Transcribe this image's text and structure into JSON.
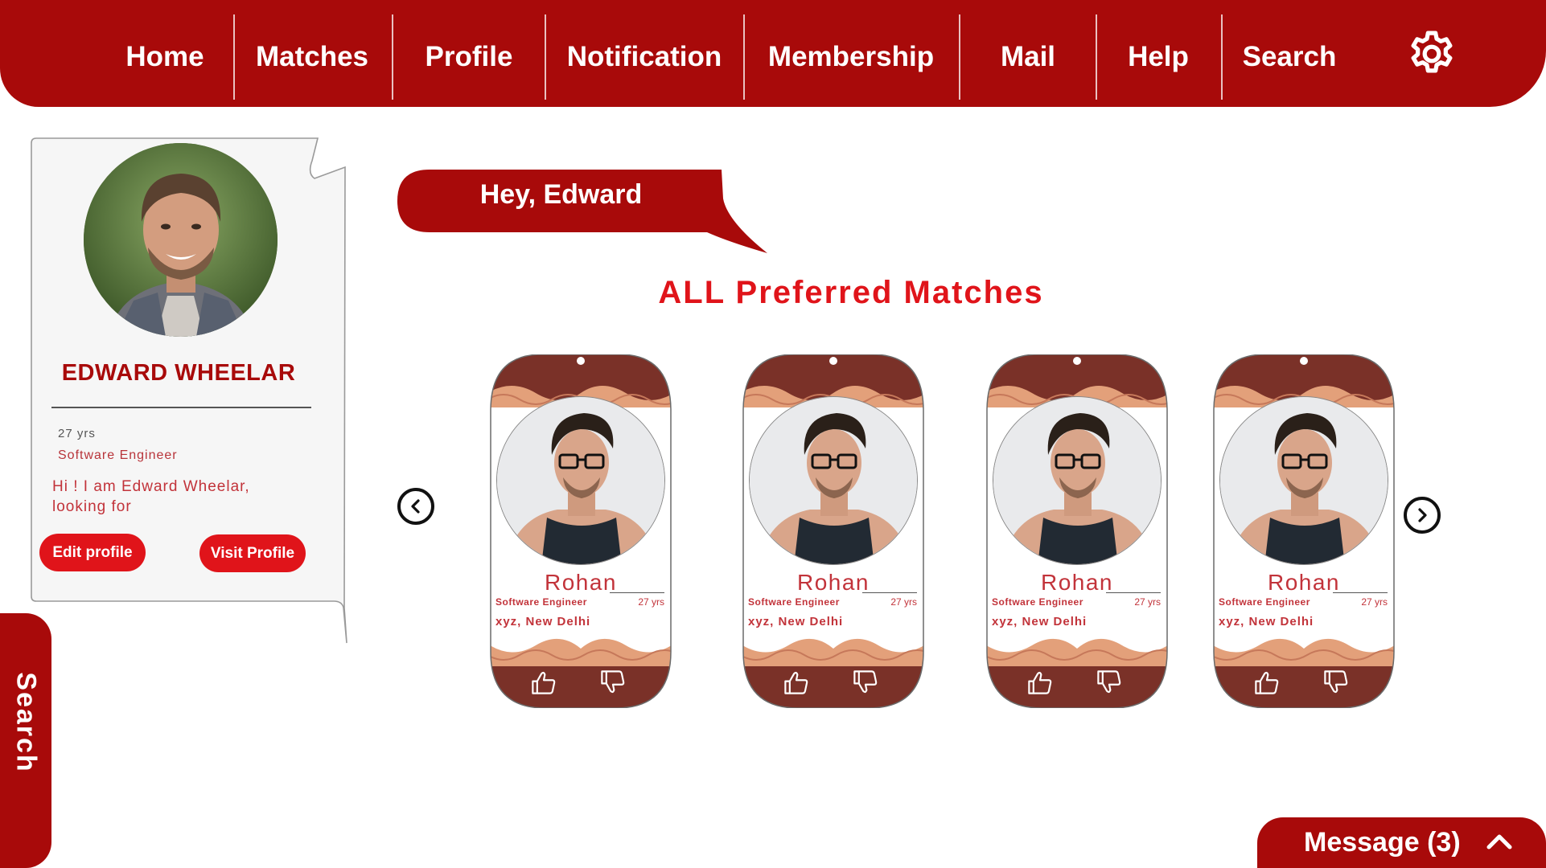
{
  "nav": {
    "items": [
      {
        "label": "Home"
      },
      {
        "label": "Matches"
      },
      {
        "label": "Profile"
      },
      {
        "label": "Notification"
      },
      {
        "label": "Membership"
      },
      {
        "label": "Mail"
      },
      {
        "label": "Help"
      },
      {
        "label": "Search"
      }
    ],
    "settings_icon": "gear-icon"
  },
  "profile": {
    "name": "EDWARD WHEELAR",
    "age": "27 yrs",
    "job": "Software Engineer",
    "bio": "Hi ! I am Edward Wheelar,\n looking for",
    "edit_label": "Edit profile",
    "visit_label": "Visit Profile"
  },
  "side_tab": {
    "label": "Search"
  },
  "greeting": "Hey, Edward",
  "section_title": "ALL Preferred Matches",
  "matches": [
    {
      "name": "Rohan",
      "job": "Software Engineer",
      "age": "27 yrs",
      "location": "xyz, New Delhi"
    },
    {
      "name": "Rohan",
      "job": "Software Engineer",
      "age": "27 yrs",
      "location": "xyz, New Delhi"
    },
    {
      "name": "Rohan",
      "job": "Software Engineer",
      "age": "27 yrs",
      "location": "xyz, New Delhi"
    },
    {
      "name": "Rohan",
      "job": "Software Engineer",
      "age": "27 yrs",
      "location": "xyz, New Delhi"
    }
  ],
  "carousel": {
    "prev_icon": "chevron-left-icon",
    "next_icon": "chevron-right-icon"
  },
  "message_bar": {
    "label": "Message (3)",
    "icon": "chevron-up-icon"
  },
  "colors": {
    "brand_red": "#a80a0a",
    "accent_red": "#e0141a",
    "card_brown": "#7a3128",
    "ornament": "#e3a07a"
  }
}
